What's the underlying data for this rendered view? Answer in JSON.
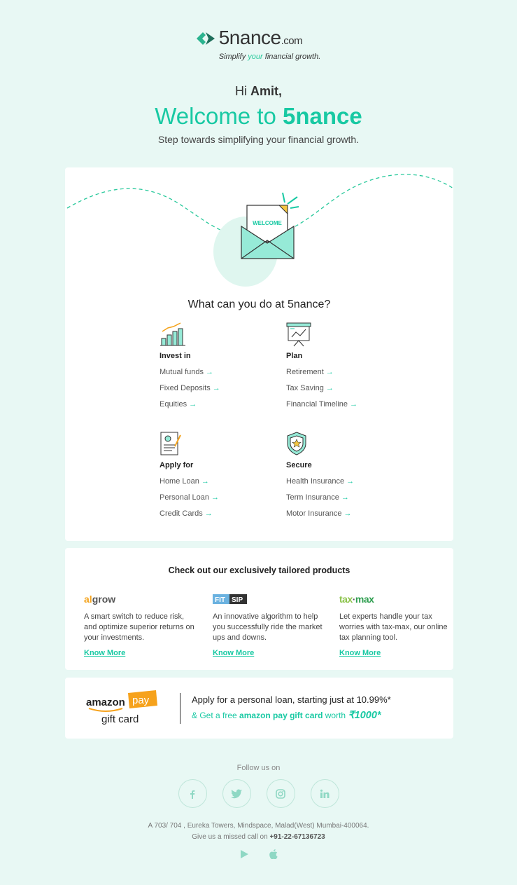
{
  "header": {
    "brand": "5nance",
    "brand_domain": ".com",
    "tagline_pre": "Simplify ",
    "tagline_your": "your",
    "tagline_post": " financial growth."
  },
  "greeting": {
    "hi": "Hi ",
    "name": "Amit,",
    "welcome_pre": "Welcome to ",
    "welcome_brand": "5nance",
    "subtitle": "Step towards simplifying your financial growth."
  },
  "illustration": {
    "envelope_text": "WELCOME"
  },
  "main": {
    "question": "What can you do at 5nance?",
    "arrow": "→",
    "categories": [
      {
        "title": "Invest in",
        "icon": "bar-chart-icon",
        "links": [
          "Mutual funds",
          "Fixed Deposits",
          "Equities"
        ]
      },
      {
        "title": "Plan",
        "icon": "presentation-board-icon",
        "links": [
          "Retirement",
          "Tax Saving",
          "Financial Timeline"
        ]
      },
      {
        "title": "Apply for",
        "icon": "application-form-icon",
        "links": [
          "Home Loan",
          "Personal Loan",
          "Credit Cards"
        ]
      },
      {
        "title": "Secure",
        "icon": "shield-star-icon",
        "links": [
          "Health Insurance",
          "Term Insurance",
          "Motor Insurance"
        ]
      }
    ]
  },
  "products": {
    "title": "Check out our exclusively tailored products",
    "items": [
      {
        "logo": "algrow",
        "desc": "A smart switch to reduce risk, and optimize superior returns on your investments.",
        "cta": "Know More"
      },
      {
        "logo": "FIT SIP",
        "desc": "An innovative algorithm to help you successfully ride the market ups and downs.",
        "cta": "Know More"
      },
      {
        "logo": "tax-max",
        "desc": "Let experts handle your tax worries with tax-max, our online tax planning tool.",
        "cta": "Know More"
      }
    ]
  },
  "amazon": {
    "logo_word": "amazon",
    "logo_pay": "pay",
    "logo_sub": "gift card",
    "line1": "Apply for a personal loan, starting just at 10.99%*",
    "line2_pre": "& Get a free ",
    "line2_bold": "amazon pay gift card",
    "line2_mid": " worth ",
    "line2_amount": "₹1000*"
  },
  "footer": {
    "follow": "Follow us on",
    "socials": [
      "facebook-icon",
      "twitter-icon",
      "instagram-icon",
      "linkedin-icon"
    ],
    "address": "A 703/ 704 , Eureka Towers, Mindspace, Malad(West) Mumbai-400064.",
    "missed_pre": "Give us a missed call on ",
    "phone": "+91-22-67136723",
    "stores": [
      "google-play-icon",
      "apple-icon"
    ]
  },
  "colors": {
    "accent": "#18c9a3",
    "background": "#e8f8f4",
    "amazon_orange": "#f6a21c"
  }
}
